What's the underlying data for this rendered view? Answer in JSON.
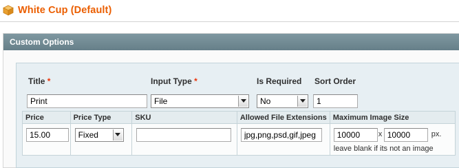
{
  "product": {
    "title": "White Cup (Default)",
    "icon": "cube-icon"
  },
  "section": {
    "header": "Custom Options"
  },
  "option": {
    "title_label": "Title",
    "title_value": "Print",
    "input_type_label": "Input Type",
    "input_type_value": "File",
    "is_required_label": "Is Required",
    "is_required_value": "No",
    "sort_order_label": "Sort Order",
    "sort_order_value": "1",
    "required_marker": "*"
  },
  "file_grid": {
    "headers": {
      "price": "Price",
      "price_type": "Price Type",
      "sku": "SKU",
      "allowed_ext": "Allowed File Extensions",
      "max_size": "Maximum Image Size"
    },
    "row": {
      "price": "15.00",
      "price_type": "Fixed",
      "sku": "",
      "allowed_ext": "jpg,png,psd,gif,jpeg",
      "max_width": "10000",
      "separator": "x",
      "max_height": "10000",
      "unit": "px.",
      "hint": "leave blank if its not an image"
    }
  },
  "colors": {
    "title_orange": "#eb5e00",
    "header_bar": "#6f8992",
    "required_red": "#eb340a"
  }
}
